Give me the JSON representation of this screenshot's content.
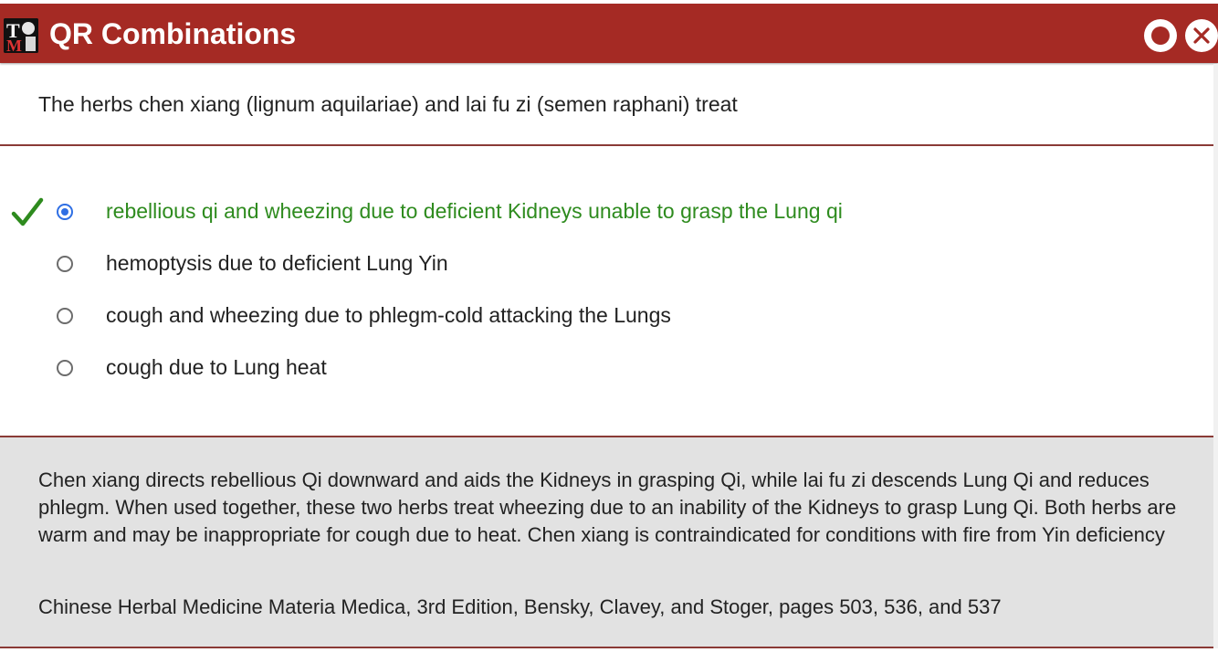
{
  "window": {
    "title": "QR Combinations",
    "header_color": "#a52a24"
  },
  "question": {
    "text": "The herbs chen xiang (lignum aquilariae) and lai fu zi (semen raphani) treat"
  },
  "choices": [
    {
      "label": "rebellious qi and wheezing due to deficient Kidneys unable to grasp the Lung qi",
      "selected": true,
      "correct": true
    },
    {
      "label": "hemoptysis due to deficient Lung Yin",
      "selected": false,
      "correct": false
    },
    {
      "label": "cough and wheezing due to phlegm-cold attacking the Lungs",
      "selected": false,
      "correct": false
    },
    {
      "label": "cough due to Lung heat",
      "selected": false,
      "correct": false
    }
  ],
  "explanation": {
    "text": "Chen xiang directs rebellious Qi downward and aids the Kidneys in grasping Qi, while lai fu zi descends Lung Qi and reduces phlegm. When used together, these two herbs treat wheezing due to an inability of the Kidneys to grasp Lung Qi. Both herbs are warm and may be inappropriate for cough due to heat. Chen xiang is contraindicated for conditions with fire from Yin deficiency",
    "reference": "Chinese Herbal Medicine Materia Medica, 3rd Edition, Bensky, Clavey, and Stoger, pages 503, 536, and 537"
  },
  "icons": {
    "logo": "tcm-tests-logo-icon",
    "record": "record-icon",
    "close": "close-icon",
    "check": "checkmark-icon"
  },
  "colors": {
    "correct": "#2e8b1e",
    "radio_selected": "#2f6fe4",
    "explanation_bg": "#e2e2e2"
  }
}
